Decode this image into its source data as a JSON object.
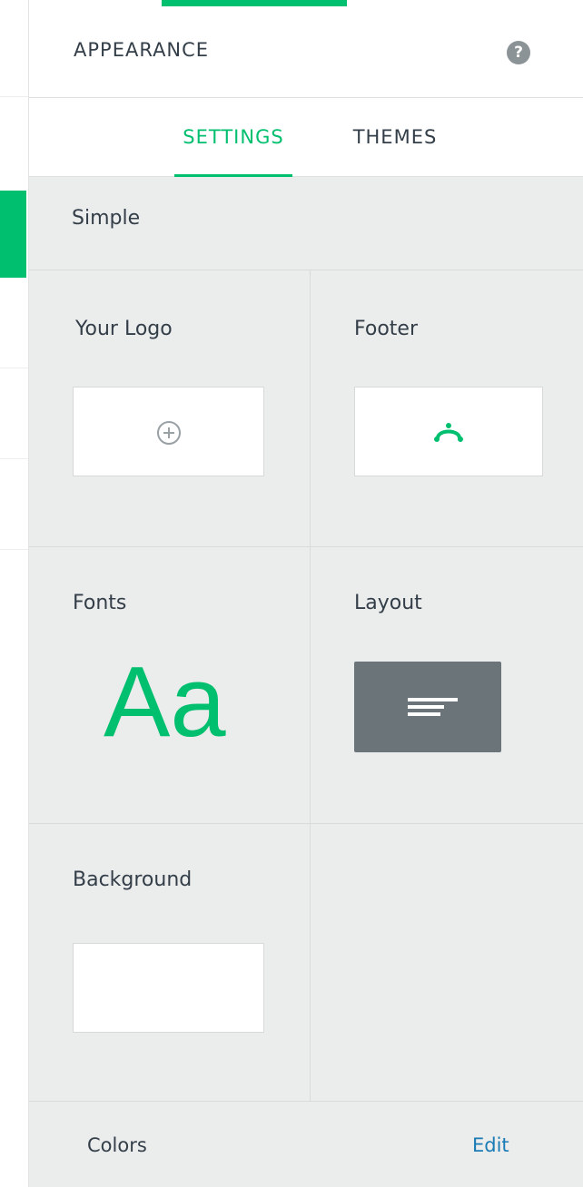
{
  "panel": {
    "title": "APPEARANCE",
    "help_icon": "question-circle-icon"
  },
  "tabs": [
    {
      "label": "SETTINGS",
      "active": true
    },
    {
      "label": "THEMES",
      "active": false
    }
  ],
  "theme": {
    "name": "Simple"
  },
  "settings": {
    "logo": {
      "label": "Your Logo",
      "icon": "add-circle-icon"
    },
    "footer": {
      "label": "Footer",
      "icon": "brand-logo-icon"
    },
    "fonts": {
      "label": "Fonts",
      "preview": "Aa"
    },
    "layout": {
      "label": "Layout",
      "icon": "left-aligned-layout-icon"
    },
    "background": {
      "label": "Background",
      "color": "#ffffff"
    }
  },
  "colors_row": {
    "label": "Colors",
    "edit_label": "Edit"
  },
  "colors": {
    "accent": "#00bf6f",
    "text": "#333e48",
    "link": "#1a7bb5",
    "panel_bg": "#ebecec"
  }
}
